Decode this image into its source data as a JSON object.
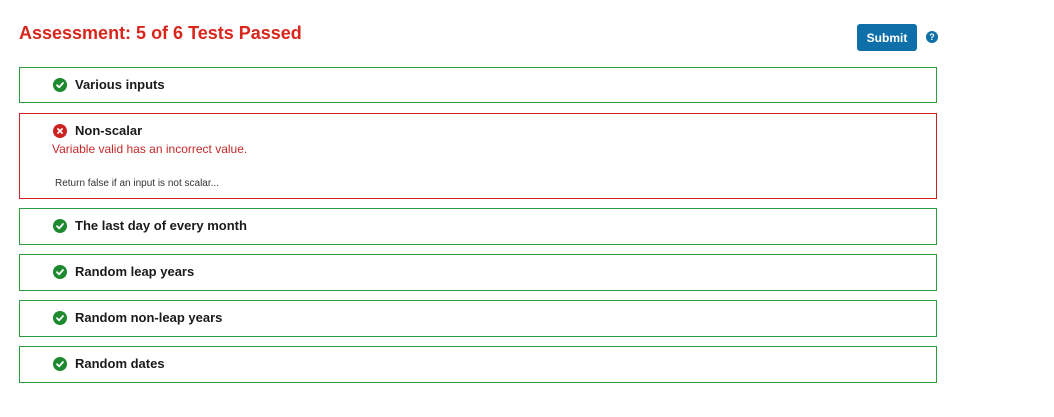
{
  "header": {
    "title": "Assessment: 5 of 6 Tests Passed",
    "submit_label": "Submit",
    "help_glyph": "?"
  },
  "colors": {
    "title": "#d9261c",
    "submit": "#0f6fa8",
    "pass": "#1e8a2f",
    "fail": "#cc2222"
  },
  "tests": [
    {
      "name": "Various inputs",
      "status": "pass",
      "icon": "check-circle-icon"
    },
    {
      "name": "Non-scalar",
      "status": "fail",
      "icon": "x-circle-icon",
      "error": "Variable valid has an incorrect value.",
      "hint": "Return false if an input is not scalar..."
    },
    {
      "name": "The last day of every month",
      "status": "pass",
      "icon": "check-circle-icon"
    },
    {
      "name": "Random leap years",
      "status": "pass",
      "icon": "check-circle-icon"
    },
    {
      "name": "Random non-leap years",
      "status": "pass",
      "icon": "check-circle-icon"
    },
    {
      "name": "Random dates",
      "status": "pass",
      "icon": "check-circle-icon"
    }
  ]
}
